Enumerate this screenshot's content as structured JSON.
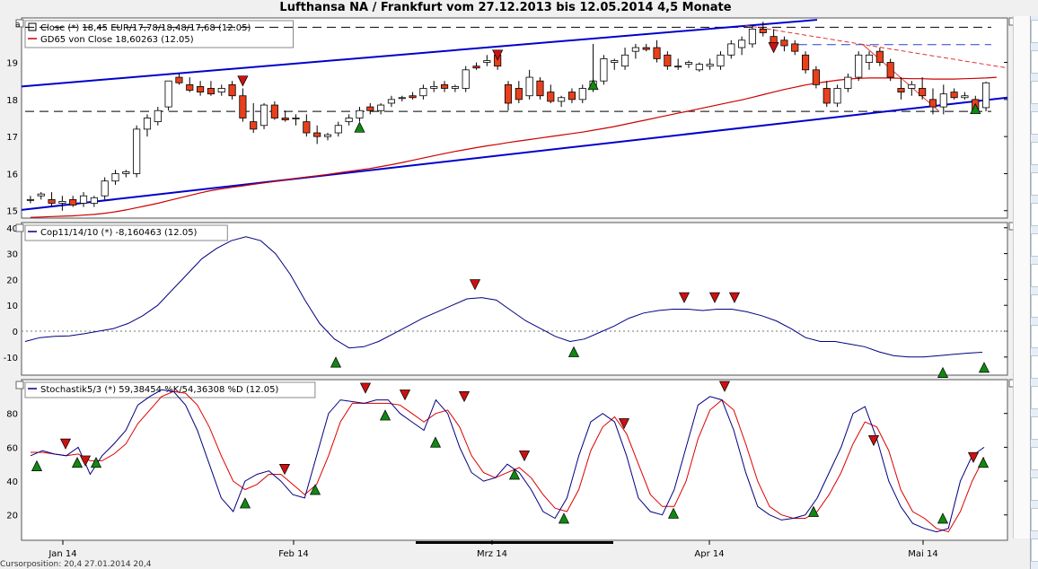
{
  "title": "Lufthansa NA / Frankfurt vom 27.12.2013 bis 12.05.2014 4,5 Monate",
  "panels": {
    "price": {
      "legend": [
        "Close (*) 18,45 EUR/17,78/18,48/17,68 (12.05)",
        "GD65 von Close 18,60263 (12.05)"
      ],
      "corner_label": "a",
      "ylim": [
        14.8,
        20.2
      ],
      "yticks": [
        15,
        16,
        17,
        18,
        19
      ]
    },
    "cop": {
      "legend": [
        "Cop11/14/10 (*) -8,160463 (12.05)"
      ],
      "ylim": [
        -17,
        42
      ],
      "yticks": [
        -10,
        0,
        10,
        20,
        30,
        40
      ]
    },
    "stoch": {
      "legend": [
        "Stochastik5/3 (*) 59,38454 %K/54,36308 %D (12.05)"
      ],
      "ylim": [
        5,
        100
      ],
      "yticks": [
        20,
        40,
        60,
        80
      ]
    }
  },
  "x_labels": [
    "Jan 14",
    "Feb 14",
    "Mrz 14",
    "Apr 14",
    "Mai 14"
  ],
  "bottom_text": "Cursorposition: 20,4          27.01.2014          20,4",
  "colors": {
    "up_candle": "#ffffff",
    "down_candle": "#e8401c",
    "trend_line": "#0000cc",
    "gd65": "#cc0000",
    "osc_line": "#000080",
    "stoch_d": "#dd0000",
    "sell_marker": "#cc1111",
    "buy_marker": "#118811"
  },
  "chart_data": [
    {
      "type": "candlestick",
      "title": "Close (*) 18,45 EUR/17,78/18,48/17,68 (12.05)",
      "series": [
        {
          "name": "Close",
          "ohlc": [
            [
              15.3,
              15.4,
              15.2,
              15.3
            ],
            [
              15.4,
              15.5,
              15.3,
              15.45
            ],
            [
              15.3,
              15.5,
              15.1,
              15.2
            ],
            [
              15.2,
              15.4,
              15.0,
              15.25
            ],
            [
              15.3,
              15.4,
              15.1,
              15.15
            ],
            [
              15.2,
              15.5,
              15.1,
              15.4
            ],
            [
              15.2,
              15.4,
              15.1,
              15.35
            ],
            [
              15.4,
              15.9,
              15.3,
              15.8
            ],
            [
              15.8,
              16.1,
              15.7,
              16.0
            ],
            [
              16.0,
              16.1,
              15.9,
              16.05
            ],
            [
              16.0,
              17.3,
              15.9,
              17.2
            ],
            [
              17.2,
              17.6,
              17.0,
              17.5
            ],
            [
              17.4,
              17.8,
              17.3,
              17.7
            ],
            [
              17.8,
              18.5,
              17.7,
              18.5
            ],
            [
              18.6,
              18.7,
              18.4,
              18.45
            ],
            [
              18.4,
              18.6,
              18.2,
              18.25
            ],
            [
              18.35,
              18.5,
              18.1,
              18.2
            ],
            [
              18.3,
              18.5,
              18.1,
              18.15
            ],
            [
              18.2,
              18.4,
              18.1,
              18.3
            ],
            [
              18.4,
              18.5,
              18.0,
              18.1
            ],
            [
              18.1,
              18.3,
              17.4,
              17.5
            ],
            [
              17.4,
              17.9,
              17.1,
              17.2
            ],
            [
              17.3,
              17.9,
              17.2,
              17.85
            ],
            [
              17.85,
              17.95,
              17.45,
              17.5
            ],
            [
              17.5,
              17.7,
              17.4,
              17.45
            ],
            [
              17.5,
              17.6,
              17.3,
              17.5
            ],
            [
              17.4,
              17.6,
              17.0,
              17.1
            ],
            [
              17.1,
              17.3,
              16.8,
              17.0
            ],
            [
              17.0,
              17.1,
              16.9,
              17.05
            ],
            [
              17.1,
              17.4,
              17.0,
              17.3
            ],
            [
              17.4,
              17.6,
              17.3,
              17.5
            ],
            [
              17.5,
              17.8,
              17.4,
              17.7
            ],
            [
              17.8,
              17.9,
              17.6,
              17.7
            ],
            [
              17.7,
              17.9,
              17.6,
              17.85
            ],
            [
              17.9,
              18.1,
              17.8,
              18.0
            ],
            [
              18.05,
              18.1,
              17.95,
              18.05
            ],
            [
              18.1,
              18.2,
              18.0,
              18.05
            ],
            [
              18.1,
              18.4,
              18.0,
              18.3
            ],
            [
              18.3,
              18.5,
              18.2,
              18.35
            ],
            [
              18.4,
              18.5,
              18.2,
              18.3
            ],
            [
              18.3,
              18.4,
              18.2,
              18.35
            ],
            [
              18.3,
              18.9,
              18.2,
              18.8
            ],
            [
              18.9,
              19.0,
              18.8,
              18.85
            ],
            [
              19.0,
              19.2,
              18.9,
              19.05
            ],
            [
              19.2,
              19.3,
              18.8,
              18.9
            ],
            [
              18.4,
              18.5,
              17.7,
              17.9
            ],
            [
              18.3,
              18.5,
              17.9,
              18.0
            ],
            [
              18.1,
              18.8,
              18.0,
              18.6
            ],
            [
              18.5,
              18.6,
              18.0,
              18.1
            ],
            [
              18.2,
              18.4,
              17.9,
              17.95
            ],
            [
              17.95,
              18.1,
              17.8,
              18.05
            ],
            [
              18.2,
              18.3,
              17.9,
              18.0
            ],
            [
              18.0,
              18.4,
              17.9,
              18.3
            ],
            [
              18.3,
              19.5,
              18.2,
              18.5
            ],
            [
              18.5,
              19.2,
              18.4,
              19.1
            ],
            [
              19.0,
              19.1,
              18.8,
              19.05
            ],
            [
              18.9,
              19.4,
              18.8,
              19.2
            ],
            [
              19.3,
              19.5,
              19.1,
              19.4
            ],
            [
              19.4,
              19.5,
              19.3,
              19.35
            ],
            [
              19.4,
              19.6,
              19.0,
              19.1
            ],
            [
              19.2,
              19.3,
              18.8,
              18.9
            ],
            [
              18.9,
              19.1,
              18.8,
              18.9
            ],
            [
              18.95,
              19.05,
              18.85,
              19.0
            ],
            [
              18.8,
              19.0,
              18.75,
              18.95
            ],
            [
              18.9,
              19.1,
              18.8,
              18.95
            ],
            [
              18.9,
              19.3,
              18.8,
              19.2
            ],
            [
              19.2,
              19.6,
              19.1,
              19.5
            ],
            [
              19.4,
              19.7,
              19.2,
              19.6
            ],
            [
              19.5,
              20.0,
              19.4,
              19.9
            ],
            [
              19.9,
              20.1,
              19.7,
              19.8
            ],
            [
              19.7,
              19.9,
              19.4,
              19.5
            ],
            [
              19.6,
              19.7,
              19.3,
              19.45
            ],
            [
              19.5,
              19.6,
              19.2,
              19.3
            ],
            [
              19.2,
              19.3,
              18.7,
              18.8
            ],
            [
              18.8,
              18.9,
              18.3,
              18.4
            ],
            [
              18.3,
              18.5,
              17.8,
              17.9
            ],
            [
              17.9,
              18.4,
              17.8,
              18.3
            ],
            [
              18.3,
              18.7,
              18.2,
              18.6
            ],
            [
              18.6,
              19.3,
              18.5,
              19.2
            ],
            [
              19.0,
              19.3,
              18.8,
              19.2
            ],
            [
              19.3,
              19.4,
              18.9,
              19.0
            ],
            [
              19.0,
              19.1,
              18.5,
              18.6
            ],
            [
              18.3,
              18.6,
              18.0,
              18.2
            ],
            [
              18.3,
              18.5,
              18.1,
              18.4
            ],
            [
              18.3,
              18.6,
              18.0,
              18.1
            ],
            [
              18.0,
              18.3,
              17.6,
              17.8
            ],
            [
              17.8,
              18.4,
              17.6,
              18.15
            ],
            [
              18.2,
              18.3,
              18.0,
              18.05
            ],
            [
              18.05,
              18.2,
              18.0,
              18.1
            ],
            [
              18.0,
              18.1,
              17.7,
              17.7
            ],
            [
              17.78,
              18.48,
              17.68,
              18.45
            ]
          ]
        },
        {
          "name": "GD65",
          "values": [
            14.82,
            14.83,
            14.84,
            14.85,
            14.86,
            14.88,
            14.9,
            14.93,
            14.97,
            15.02,
            15.08,
            15.14,
            15.2,
            15.27,
            15.34,
            15.41,
            15.48,
            15.54,
            15.59,
            15.63,
            15.67,
            15.71,
            15.75,
            15.79,
            15.83,
            15.87,
            15.91,
            15.94,
            15.98,
            16.02,
            16.06,
            16.1,
            16.14,
            16.19,
            16.24,
            16.3,
            16.36,
            16.42,
            16.48,
            16.54,
            16.6,
            16.65,
            16.7,
            16.75,
            16.79,
            16.84,
            16.88,
            16.92,
            16.96,
            17.0,
            17.04,
            17.08,
            17.12,
            17.17,
            17.22,
            17.27,
            17.33,
            17.39,
            17.45,
            17.51,
            17.57,
            17.63,
            17.69,
            17.75,
            17.81,
            17.87,
            17.93,
            17.99,
            18.06,
            18.13,
            18.2,
            18.27,
            18.33,
            18.39,
            18.44,
            18.48,
            18.52,
            18.55,
            18.57,
            18.58,
            18.58,
            18.58,
            18.57,
            18.56,
            18.56,
            18.55,
            18.55,
            18.55,
            18.56,
            18.57,
            18.58,
            18.6
          ]
        }
      ],
      "ylim": [
        14.8,
        20.2
      ]
    },
    {
      "type": "line",
      "title": "Cop11/14/10 (*) -8,160463 (12.05)",
      "series": [
        {
          "name": "Cop11/14/10",
          "values": [
            -4,
            -2.5,
            -2,
            -1.8,
            -1,
            0,
            1,
            3,
            6,
            10,
            16,
            22,
            28,
            32,
            35,
            36.5,
            35,
            30,
            22,
            12,
            3,
            -3,
            -6.5,
            -6,
            -4,
            -1,
            2,
            5,
            7.5,
            10,
            12.5,
            13,
            12,
            8,
            4,
            1,
            -2,
            -4,
            -3,
            -0.5,
            2,
            5,
            7,
            8,
            8.5,
            8.5,
            8,
            8.5,
            8.5,
            7.5,
            6,
            4,
            1,
            -2.5,
            -4,
            -4,
            -5,
            -6,
            -8,
            -9.5,
            -10,
            -10,
            -9.5,
            -9,
            -8.5,
            -8.16
          ]
        }
      ],
      "ylim": [
        -17,
        42
      ]
    },
    {
      "type": "line",
      "title": "Stochastik5/3 (*) 59,38454 %K/54,36308 %D (12.05)",
      "series": [
        {
          "name": "%K",
          "values": [
            55,
            58,
            56,
            55,
            60,
            44,
            55,
            62,
            70,
            85,
            90,
            94,
            93,
            85,
            70,
            50,
            30,
            22,
            40,
            44,
            46,
            40,
            32,
            30,
            55,
            80,
            88,
            87,
            86,
            88,
            88,
            80,
            75,
            70,
            88,
            80,
            60,
            45,
            40,
            42,
            50,
            45,
            35,
            22,
            18,
            30,
            55,
            75,
            80,
            75,
            55,
            30,
            22,
            20,
            35,
            60,
            85,
            90,
            88,
            70,
            45,
            25,
            20,
            17,
            18,
            20,
            30,
            45,
            60,
            80,
            84,
            65,
            40,
            25,
            15,
            12,
            10,
            12,
            40,
            55,
            60
          ]
        },
        {
          "name": "%D",
          "values": [
            57,
            57,
            56,
            55,
            56,
            52,
            52,
            56,
            62,
            74,
            82,
            90,
            93,
            92,
            85,
            72,
            55,
            40,
            35,
            38,
            44,
            44,
            38,
            32,
            38,
            55,
            75,
            86,
            86,
            86,
            86,
            85,
            80,
            75,
            80,
            82,
            72,
            55,
            45,
            42,
            45,
            48,
            42,
            32,
            24,
            22,
            35,
            58,
            72,
            78,
            68,
            50,
            32,
            25,
            25,
            40,
            65,
            82,
            88,
            82,
            62,
            40,
            25,
            20,
            18,
            18,
            22,
            32,
            45,
            62,
            75,
            72,
            58,
            35,
            22,
            18,
            12,
            10,
            22,
            40,
            54
          ]
        }
      ],
      "ylim": [
        5,
        100
      ]
    }
  ]
}
